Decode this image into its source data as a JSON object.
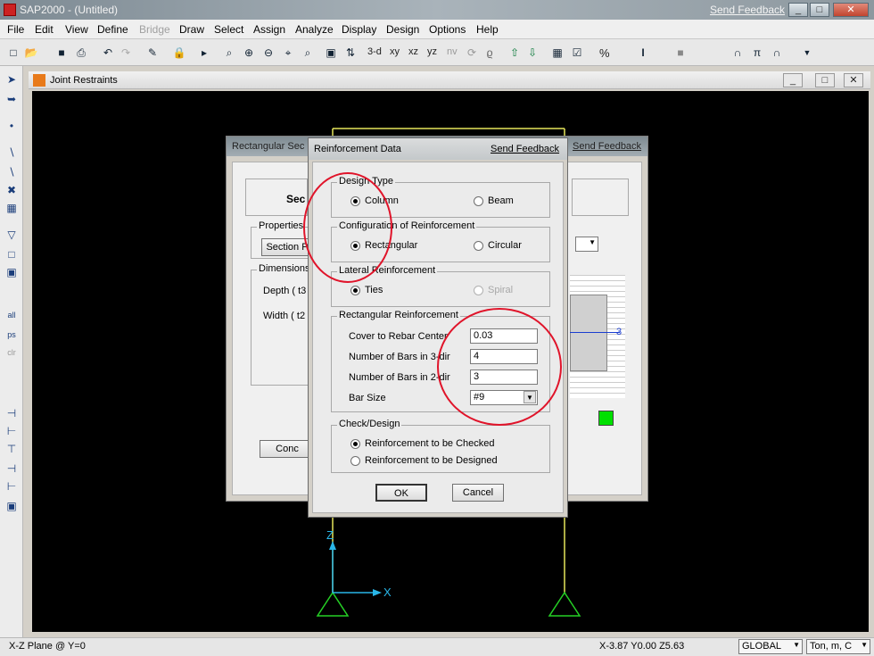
{
  "app": {
    "title": "SAP2000 - (Untitled)",
    "send_feedback": "Send Feedback",
    "min": "_",
    "max": "□",
    "close": "✕"
  },
  "menu": [
    "File",
    "Edit",
    "View",
    "Define",
    "Bridge",
    "Draw",
    "Select",
    "Assign",
    "Analyze",
    "Display",
    "Design",
    "Options",
    "Help"
  ],
  "toolbar": {
    "view_3d": "3-d",
    "view_xy": "xy",
    "view_xz": "xz",
    "view_yz": "yz",
    "view_nv": "nv",
    "percent": "%"
  },
  "canvas_window": {
    "title": "Joint Restraints",
    "axis_z": "Z",
    "axis_x": "X",
    "axis_marker": "3"
  },
  "back_dialog": {
    "title": "Rectangular Sec",
    "send_feedback": "Send Feedback",
    "section_label": "Sec",
    "properties_label": "Properties",
    "section_btn": "Section P",
    "dimensions_label": "Dimensions",
    "depth_label": "Depth  ( t3",
    "width_label": "Width  ( t2",
    "concrete_btn": "Conc"
  },
  "dialog": {
    "title": "Reinforcement Data",
    "send_feedback": "Send Feedback",
    "design_type": {
      "label": "Design Type",
      "column": "Column",
      "beam": "Beam",
      "selected": "Column"
    },
    "configuration": {
      "label": "Configuration of Reinforcement",
      "rectangular": "Rectangular",
      "circular": "Circular",
      "selected": "Rectangular"
    },
    "lateral": {
      "label": "Lateral Reinforcement",
      "ties": "Ties",
      "spiral": "Spiral",
      "selected": "Ties"
    },
    "rect": {
      "label": "Rectangular Reinforcement",
      "cover_label": "Cover to Rebar Center",
      "cover_value": "0.03",
      "bars3_label": "Number of Bars in 3-dir",
      "bars3_value": "4",
      "bars2_label": "Number of Bars in 2-dir",
      "bars2_value": "3",
      "barsize_label": "Bar Size",
      "barsize_value": "#9"
    },
    "check": {
      "label": "Check/Design",
      "checked": "Reinforcement to be Checked",
      "designed": "Reinforcement to be Designed",
      "selected": "Reinforcement to be Checked"
    },
    "ok": "OK",
    "cancel": "Cancel"
  },
  "status": {
    "left": "X-Z Plane @ Y=0",
    "coords": "X-3.87  Y0.00  Z5.63",
    "coord_system": "GLOBAL",
    "units": "Ton, m, C"
  },
  "colors": {
    "annotation": "#e0142a",
    "frame": "#e6e65a",
    "support": "#25d025",
    "axis": "#29b6e8",
    "green_swatch": "#00e000"
  }
}
